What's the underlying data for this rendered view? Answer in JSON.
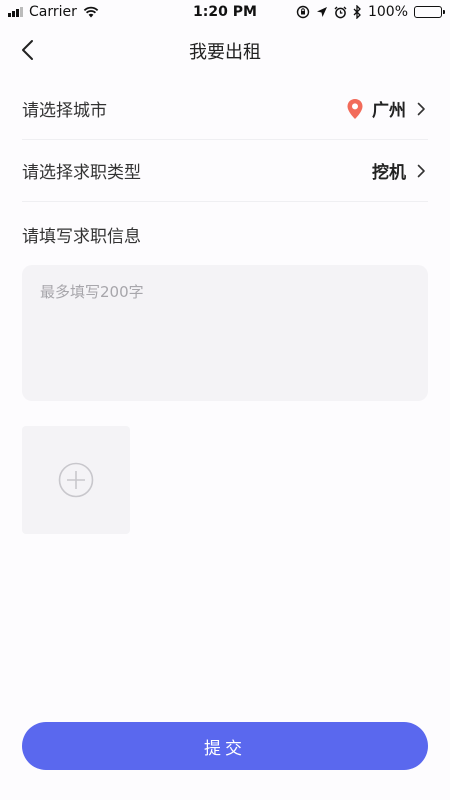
{
  "status_bar": {
    "carrier": "Carrier",
    "time": "1:20 PM",
    "battery": "100%"
  },
  "nav": {
    "title": "我要出租"
  },
  "form": {
    "city_label": "请选择城市",
    "city_value": "广州",
    "type_label": "请选择求职类型",
    "type_value": "挖机",
    "info_label": "请填写求职信息",
    "info_placeholder": "最多填写200字"
  },
  "submit_label": "提交",
  "colors": {
    "accent": "#5a68ee",
    "pin": "#f26b5a",
    "field_bg": "#f4f3f6"
  }
}
